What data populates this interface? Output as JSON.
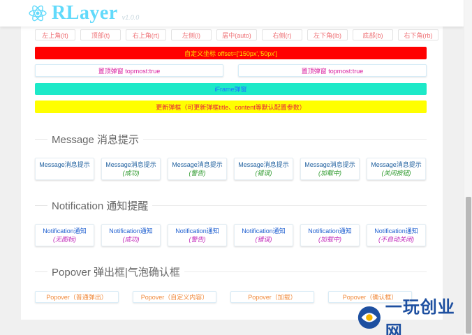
{
  "header": {
    "title": "RLayer",
    "version": "v1.0.0"
  },
  "positions": [
    "左上角(lt)",
    "顶部(t)",
    "右上角(rt)",
    "左侧(l)",
    "居中(auto)",
    "右侧(r)",
    "左下角(lb)",
    "底部(b)",
    "右下角(rb)"
  ],
  "custom_offset_label": "自定义坐标 offset=['150px','50px']",
  "topmost_buttons": [
    "置顶弹窗 topmost:true",
    "置顶弹窗 topmost:true"
  ],
  "iframe_label": "iFrame弹窗",
  "update_label": "更新弹框（可更新弹框title、content等默认配置参数）",
  "sections": {
    "message": "Message 消息提示",
    "notification": "Notification 通知提醒",
    "popover": "Popover 弹出框|气泡确认框"
  },
  "message_buttons": [
    {
      "line1": "Message消息提示",
      "line2": ""
    },
    {
      "line1": "Message消息提示",
      "line2": "(成功)"
    },
    {
      "line1": "Message消息提示",
      "line2": "(警告)"
    },
    {
      "line1": "Message消息提示",
      "line2": "(错误)"
    },
    {
      "line1": "Message消息提示",
      "line2": "(加载中)"
    },
    {
      "line1": "Message消息提示",
      "line2": "(关闭按钮)"
    }
  ],
  "notification_buttons": [
    {
      "line1": "Notification通知",
      "line2": "(无图标)"
    },
    {
      "line1": "Notification通知",
      "line2": "(成功)"
    },
    {
      "line1": "Notification通知",
      "line2": "(警告)"
    },
    {
      "line1": "Notification通知",
      "line2": "(错误)"
    },
    {
      "line1": "Notification通知",
      "line2": "(加载中)"
    },
    {
      "line1": "Notification通知",
      "line2": "(不自动关闭)"
    }
  ],
  "popover_buttons": [
    "Popover（普通弹出）",
    "Popover（自定义内容）",
    "Popover（加载）",
    "Popover（确认框）"
  ],
  "watermark": {
    "text": "一玩创业网"
  },
  "colors": {
    "brand": "#61dafb",
    "red_bar": "#ff0000",
    "cyan_bar": "#1de9c8",
    "yellow_bar": "#ffff00"
  }
}
